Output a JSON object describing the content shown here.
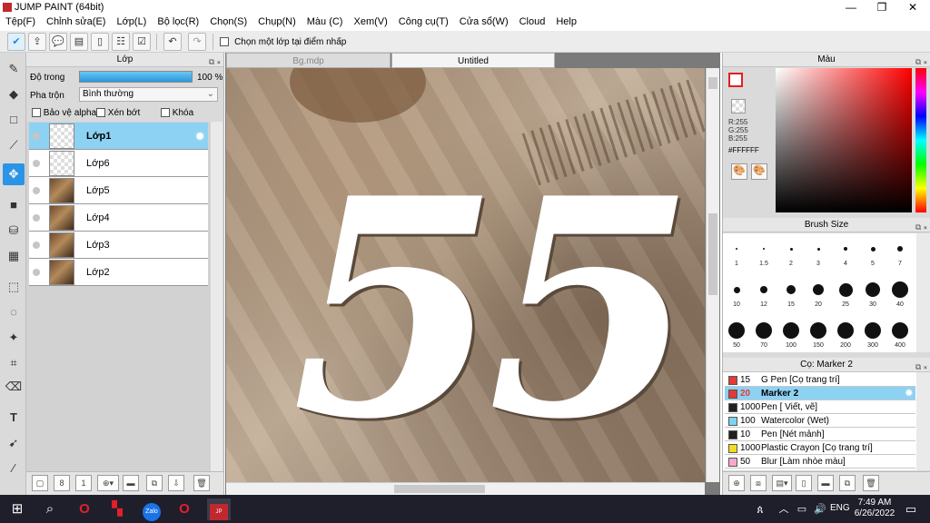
{
  "window": {
    "title": "JUMP PAINT (64bit)",
    "min": "—",
    "max": "❐",
    "close": "✕"
  },
  "menu": [
    "Tệp(F)",
    "Chỉnh sửa(E)",
    "Lớp(L)",
    "Bộ lọc(R)",
    "Chọn(S)",
    "Chụp(N)",
    "Màu (C)",
    "Xem(V)",
    "Công cụ(T)",
    "Cửa sổ(W)",
    "Cloud",
    "Help"
  ],
  "toolbar": {
    "option_label": "Chọn một lớp tại điểm nhấp"
  },
  "layer_panel": {
    "title": "Lớp",
    "opacity_label": "Độ trong",
    "opacity_value": "100 %",
    "opacity_fraction": 1.0,
    "blend_label": "Pha trộn",
    "blend_value": "Bình thường",
    "opt_alpha": "Bảo vệ alpha",
    "opt_clip": "Xén bớt",
    "opt_lock": "Khóa",
    "layers": [
      "Lớp1",
      "Lớp6",
      "Lớp5",
      "Lớp4",
      "Lớp3",
      "Lớp2"
    ]
  },
  "tabs": [
    "Bg.mdp",
    "Untitled"
  ],
  "color_panel": {
    "title": "Màu",
    "r": "R:255",
    "g": "G:255",
    "b": "B:255",
    "hex": "#FFFFFF"
  },
  "brush_size_panel": {
    "title": "Brush Size",
    "sizes": [
      "1",
      "1.5",
      "2",
      "3",
      "4",
      "5",
      "7",
      "10",
      "12",
      "15",
      "20",
      "25",
      "30",
      "40",
      "50",
      "70",
      "100",
      "150",
      "200",
      "300",
      "400"
    ]
  },
  "brush_panel": {
    "title": "Cọ: Marker 2",
    "brushes": [
      {
        "size": "15",
        "name": "G Pen [Cọ trang trí]",
        "color": "#e53935"
      },
      {
        "size": "20",
        "name": "Marker 2",
        "color": "#e53935"
      },
      {
        "size": "1000",
        "name": "Pen [ Viết, vẽ]",
        "color": "#212121"
      },
      {
        "size": "100",
        "name": "Watercolor (Wet)",
        "color": "#7fd3f0"
      },
      {
        "size": "10",
        "name": "Pen [Nét mảnh]",
        "color": "#212121"
      },
      {
        "size": "1000",
        "name": "Plastic Crayon [Cọ trang trí]",
        "color": "#f2dc1f"
      },
      {
        "size": "50",
        "name": "Blur [Làm nhòe màu]",
        "color": "#f7a8d0"
      }
    ]
  },
  "canvas_art": {
    "text": "55"
  },
  "taskbar": {
    "time": "7:49 AM",
    "date": "6/26/2022",
    "lang": "ENG"
  }
}
